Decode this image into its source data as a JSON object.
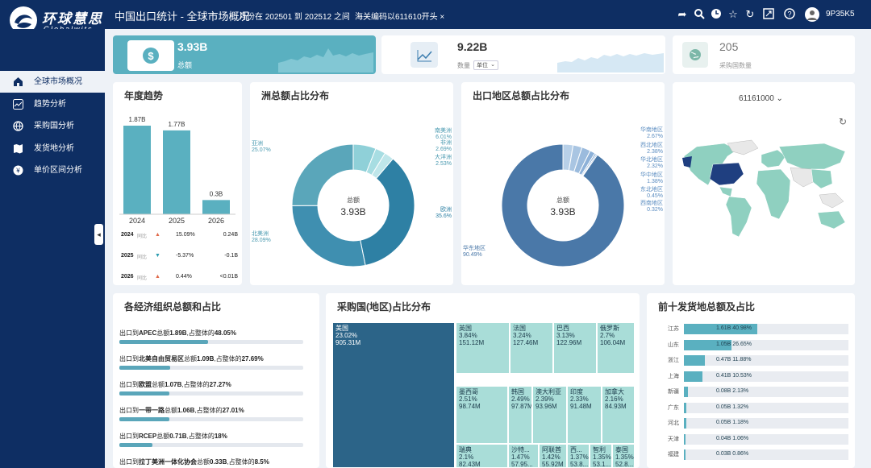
{
  "header": {
    "logo_cn": "环球慧思",
    "logo_en": "Globalwits",
    "title": "中国出口统计 - 全球市场概况",
    "date_range": "月份在 202501 到 202512 之间",
    "filter": "海关编码以611610开头",
    "user": "9P35K5"
  },
  "sidebar": {
    "items": [
      {
        "label": "全球市场概况"
      },
      {
        "label": "趋势分析"
      },
      {
        "label": "采购国分析"
      },
      {
        "label": "发货地分析"
      },
      {
        "label": "单价区间分析"
      }
    ]
  },
  "kpis": {
    "total": {
      "value": "3.93B",
      "label": "总额"
    },
    "qty": {
      "value": "9.22B",
      "label": "数量",
      "unit": "单位"
    },
    "buyers": {
      "value": "205",
      "label": "采购国数量"
    }
  },
  "annual": {
    "title": "年度趋势",
    "years": [
      {
        "year": "2024",
        "value": "1.87B",
        "change": "15.09%",
        "delta": "0.24B",
        "dir": "up"
      },
      {
        "year": "2025",
        "value": "1.77B",
        "change": "-5.37%",
        "delta": "-0.1B",
        "dir": "down"
      },
      {
        "year": "2026",
        "value": "0.3B",
        "change": "0.44%",
        "delta": "<0.01B",
        "dir": "up"
      }
    ],
    "compare_label": "同比"
  },
  "continent": {
    "title": "洲总额占比分布",
    "center_label": "总额",
    "center_value": "3.93B",
    "labels": [
      {
        "name": "南美洲",
        "pct": "6.01%"
      },
      {
        "name": "非洲",
        "pct": "2.69%"
      },
      {
        "name": "大洋洲",
        "pct": "2.53%"
      },
      {
        "name": "欧洲",
        "pct": "35.6%"
      },
      {
        "name": "北美洲",
        "pct": "28.09%"
      },
      {
        "name": "亚洲",
        "pct": "25.07%"
      }
    ]
  },
  "region": {
    "title": "出口地区总额占比分布",
    "center_label": "总额",
    "center_value": "3.93B",
    "labels": [
      {
        "name": "华南地区",
        "pct": "2.67%"
      },
      {
        "name": "西北地区",
        "pct": "2.38%"
      },
      {
        "name": "华北地区",
        "pct": "2.32%"
      },
      {
        "name": "华中地区",
        "pct": "1.38%"
      },
      {
        "name": "东北地区",
        "pct": "0.45%"
      },
      {
        "name": "西南地区",
        "pct": "0.32%"
      },
      {
        "name": "华东地区",
        "pct": "90.49%"
      }
    ]
  },
  "map": {
    "code": "61161000"
  },
  "econ": {
    "title": "各经济组织总额和占比",
    "rows": [
      {
        "pre": "出口到",
        "org": "APEC",
        "mid": "总额",
        "val": "1.89B",
        "post": ",占整体的",
        "pct": "48.05%",
        "fill": 0.4805
      },
      {
        "pre": "出口到",
        "org": "北美自由贸易区",
        "mid": "总额",
        "val": "1.09B",
        "post": ",占整体的",
        "pct": "27.69%",
        "fill": 0.2769
      },
      {
        "pre": "出口到",
        "org": "欧盟",
        "mid": "总额",
        "val": "1.07B",
        "post": ",占整体的",
        "pct": "27.27%",
        "fill": 0.2727
      },
      {
        "pre": "出口到",
        "org": "一带一路",
        "mid": "总额",
        "val": "1.06B",
        "post": ",占整体的",
        "pct": "27.01%",
        "fill": 0.2701
      },
      {
        "pre": "出口到",
        "org": "RCEP",
        "mid": "总额",
        "val": "0.71B",
        "post": ",占整体的",
        "pct": "18%",
        "fill": 0.18
      },
      {
        "pre": "出口到",
        "org": "拉丁美洲一体化协会",
        "mid": "总额",
        "val": "0.33B",
        "post": ",占整体的",
        "pct": "8.5%",
        "fill": 0.085
      }
    ]
  },
  "treemap": {
    "title": "采购国(地区)占比分布",
    "cells": [
      {
        "name": "美国",
        "pct": "23.02%",
        "val": "905.31M"
      },
      {
        "name": "英国",
        "pct": "3.84%",
        "val": "151.12M"
      },
      {
        "name": "法国",
        "pct": "3.24%",
        "val": "127.46M"
      },
      {
        "name": "巴西",
        "pct": "3.13%",
        "val": "122.96M"
      },
      {
        "name": "俄罗斯",
        "pct": "2.7%",
        "val": "106.04M"
      },
      {
        "name": "墨西哥",
        "pct": "2.51%",
        "val": "98.74M"
      },
      {
        "name": "韩国",
        "pct": "2.49%",
        "val": "97.87M"
      },
      {
        "name": "澳大利亚",
        "pct": "2.39%",
        "val": "93.96M"
      },
      {
        "name": "印度",
        "pct": "2.33%",
        "val": "91.48M"
      },
      {
        "name": "加拿大",
        "pct": "2.16%",
        "val": "84.93M"
      },
      {
        "name": "瑞典",
        "pct": "2.1%",
        "val": "82.43M"
      },
      {
        "name": "沙特...",
        "pct": "1.47%",
        "val": "57.95..."
      },
      {
        "name": "阿联酋",
        "pct": "1.42%",
        "val": "55.92M"
      },
      {
        "name": "西...",
        "pct": "1.37%",
        "val": "53.8..."
      },
      {
        "name": "智利",
        "pct": "1.35%",
        "val": "53.1..."
      },
      {
        "name": "泰国",
        "pct": "1.35%",
        "val": "52.8..."
      }
    ]
  },
  "ranking": {
    "title": "前十发货地总额及占比",
    "rows": [
      {
        "name": "江苏",
        "val": "1.61B",
        "pct": "40.98%",
        "fill": 0.4098
      },
      {
        "name": "山东",
        "val": "1.05B",
        "pct": "26.65%",
        "fill": 0.2665
      },
      {
        "name": "浙江",
        "val": "0.47B",
        "pct": "11.88%",
        "fill": 0.1188
      },
      {
        "name": "上海",
        "val": "0.41B",
        "pct": "10.53%",
        "fill": 0.1053
      },
      {
        "name": "新疆",
        "val": "0.08B",
        "pct": "2.13%",
        "fill": 0.0213
      },
      {
        "name": "广东",
        "val": "0.05B",
        "pct": "1.32%",
        "fill": 0.0132
      },
      {
        "name": "河北",
        "val": "0.05B",
        "pct": "1.18%",
        "fill": 0.0118
      },
      {
        "name": "天津",
        "val": "0.04B",
        "pct": "1.06%",
        "fill": 0.0106
      },
      {
        "name": "福建",
        "val": "0.03B",
        "pct": "0.86%",
        "fill": 0.0086
      }
    ]
  },
  "colors": {
    "nav": "#0e2e63",
    "teal": "#5aa6ba",
    "donut1": "#2f7ea0",
    "donut2": "#4a78a8",
    "map_fill": "#8fd0c0",
    "map_hl": "#1f3f80"
  }
}
